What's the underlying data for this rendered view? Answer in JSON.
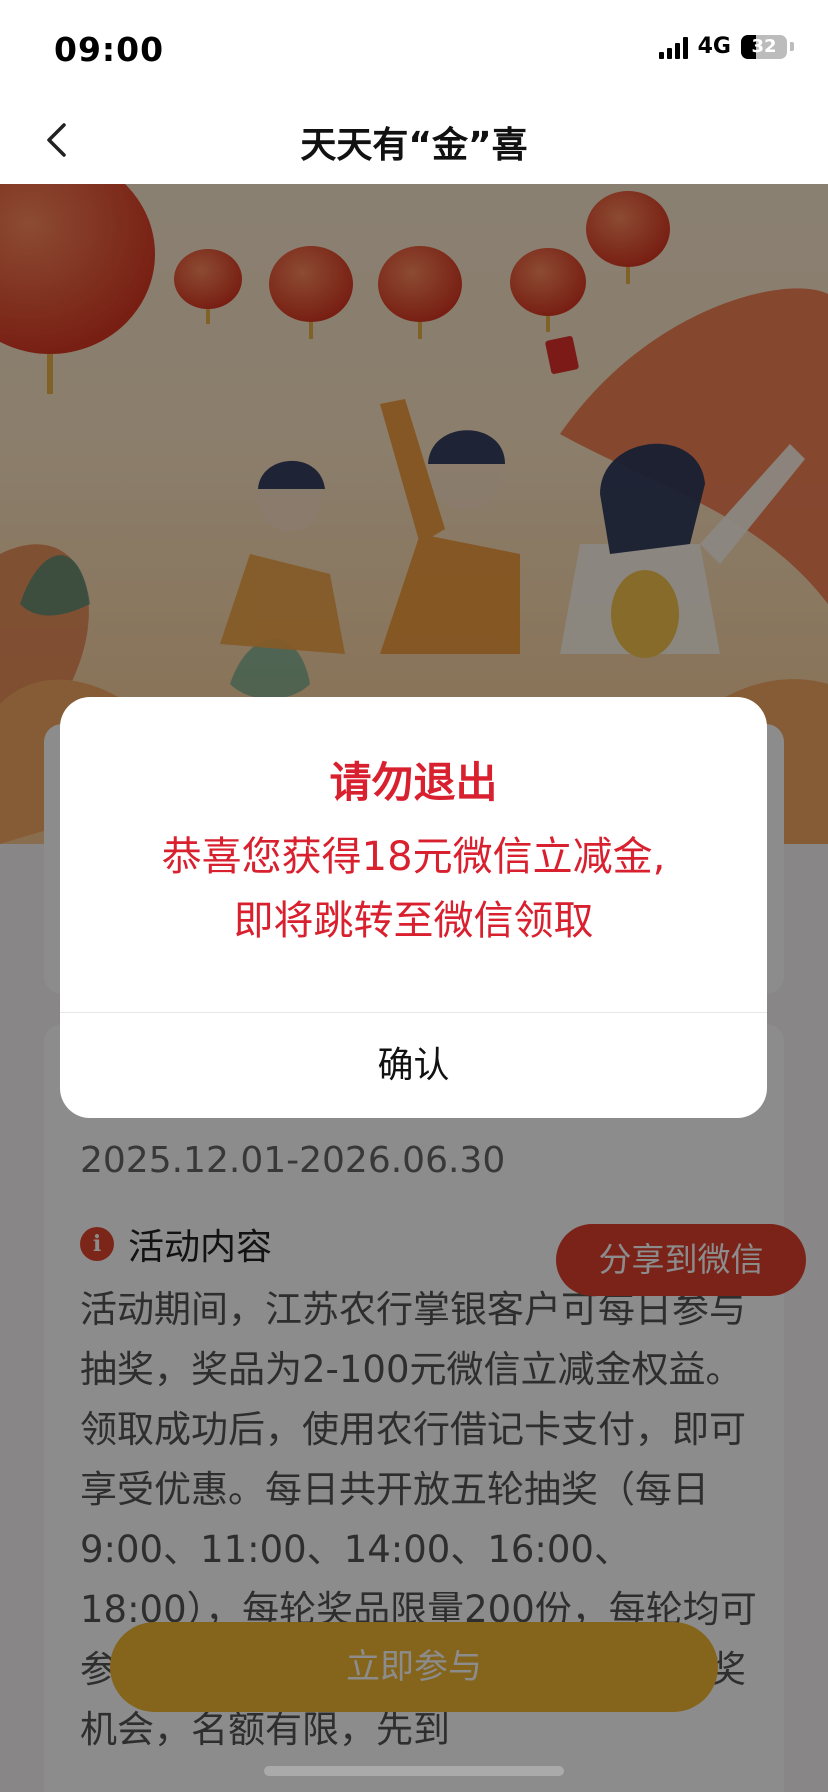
{
  "status_bar": {
    "time": "09:00",
    "network": "4G",
    "battery": "32",
    "battery_level": 0.32
  },
  "nav": {
    "title": "天天有“金”喜"
  },
  "dialog": {
    "title": "请勿退出",
    "message_line1": "恭喜您获得18元微信立减金,",
    "message_line2": "即将跳转至微信领取",
    "confirm_label": "确认"
  },
  "activity": {
    "date_range": "2025.12.01-2026.06.30",
    "section_title": "活动内容",
    "description": "活动期间，江苏农行掌银客户可每日参与抽奖，奖品为2-100元微信立减金权益。领取成功后，使用农行借记卡支付，即可享受优惠。每日共开放五轮抽奖（每日9:00、11:00、14:00、16:00、18:00），每轮奖品限量200份，每轮均可参与抽奖，但一个自然月内仅有一次中奖机会，名额有限，先到",
    "share_label": "分享到微信",
    "join_label": "立即参与"
  },
  "colors": {
    "accent_red": "#d9202f",
    "button_red": "#e0402f",
    "button_gold": "#f2b632"
  }
}
